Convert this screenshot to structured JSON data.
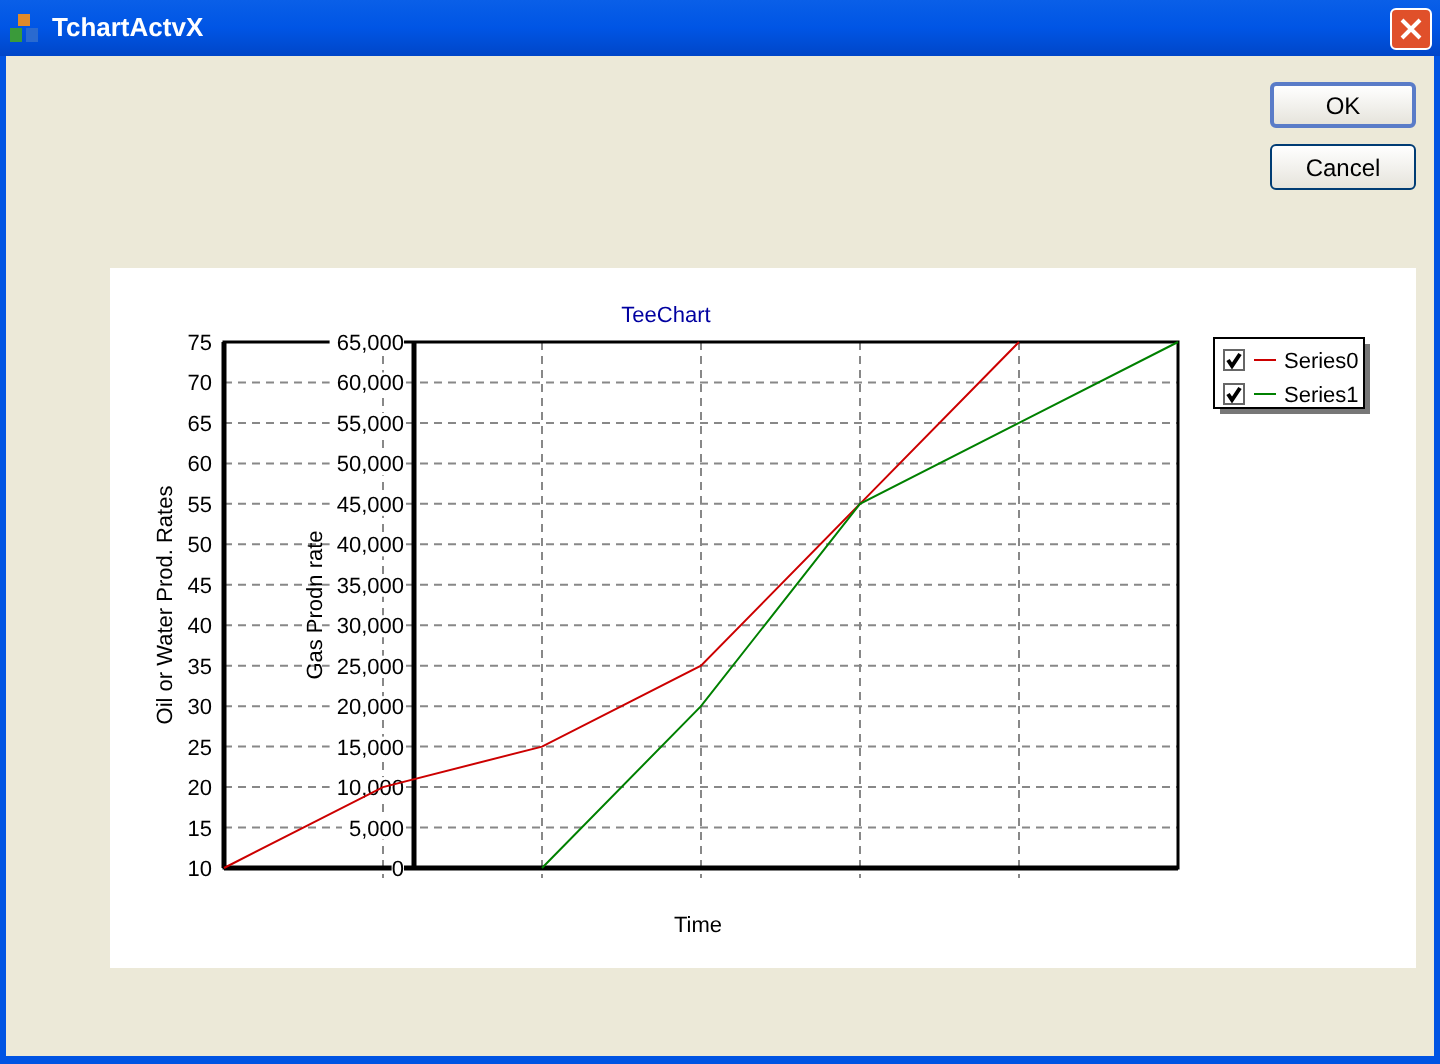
{
  "window": {
    "title": "TchartActvX"
  },
  "buttons": [
    {
      "label": "OK",
      "default": true
    },
    {
      "label": "Cancel",
      "default": false
    }
  ],
  "chart": {
    "chart_data": {
      "type": "line",
      "grid": true,
      "legend": "right",
      "title": "TeeChart",
      "xlabel": "Time",
      "ylabel": "Oil or Water Prod. Rates",
      "ylim": [
        10,
        75
      ],
      "yticks": [
        10,
        15,
        20,
        25,
        30,
        35,
        40,
        45,
        50,
        55,
        60,
        65,
        70,
        75
      ],
      "y2label": "Gas Prodn rate",
      "y2lim": [
        0,
        65000
      ],
      "y2ticks": [
        {
          "value": 0,
          "label": "0"
        },
        {
          "value": 5000,
          "label": "5,000"
        },
        {
          "value": 10000,
          "label": "10,000"
        },
        {
          "value": 15000,
          "label": "15,000"
        },
        {
          "value": 20000,
          "label": "20,000"
        },
        {
          "value": 25000,
          "label": "25,000"
        },
        {
          "value": 30000,
          "label": "30,000"
        },
        {
          "value": 35000,
          "label": "35,000"
        },
        {
          "value": 40000,
          "label": "40,000"
        },
        {
          "value": 45000,
          "label": "45,000"
        },
        {
          "value": 50000,
          "label": "50,000"
        },
        {
          "value": 55000,
          "label": "55,000"
        },
        {
          "value": 60000,
          "label": "60,000"
        },
        {
          "value": 65000,
          "label": "65,000"
        }
      ],
      "series": [
        {
          "name": "Series0",
          "color": "#cc0000",
          "values": [
            10,
            20,
            25,
            35,
            55,
            75,
            null
          ]
        },
        {
          "name": "Series1",
          "color": "#008000",
          "axis": "y2",
          "values": [
            null,
            null,
            0,
            20000,
            45000,
            55000,
            65000
          ]
        }
      ]
    },
    "legend": [
      {
        "checked": true
      },
      {
        "checked": true
      }
    ]
  }
}
